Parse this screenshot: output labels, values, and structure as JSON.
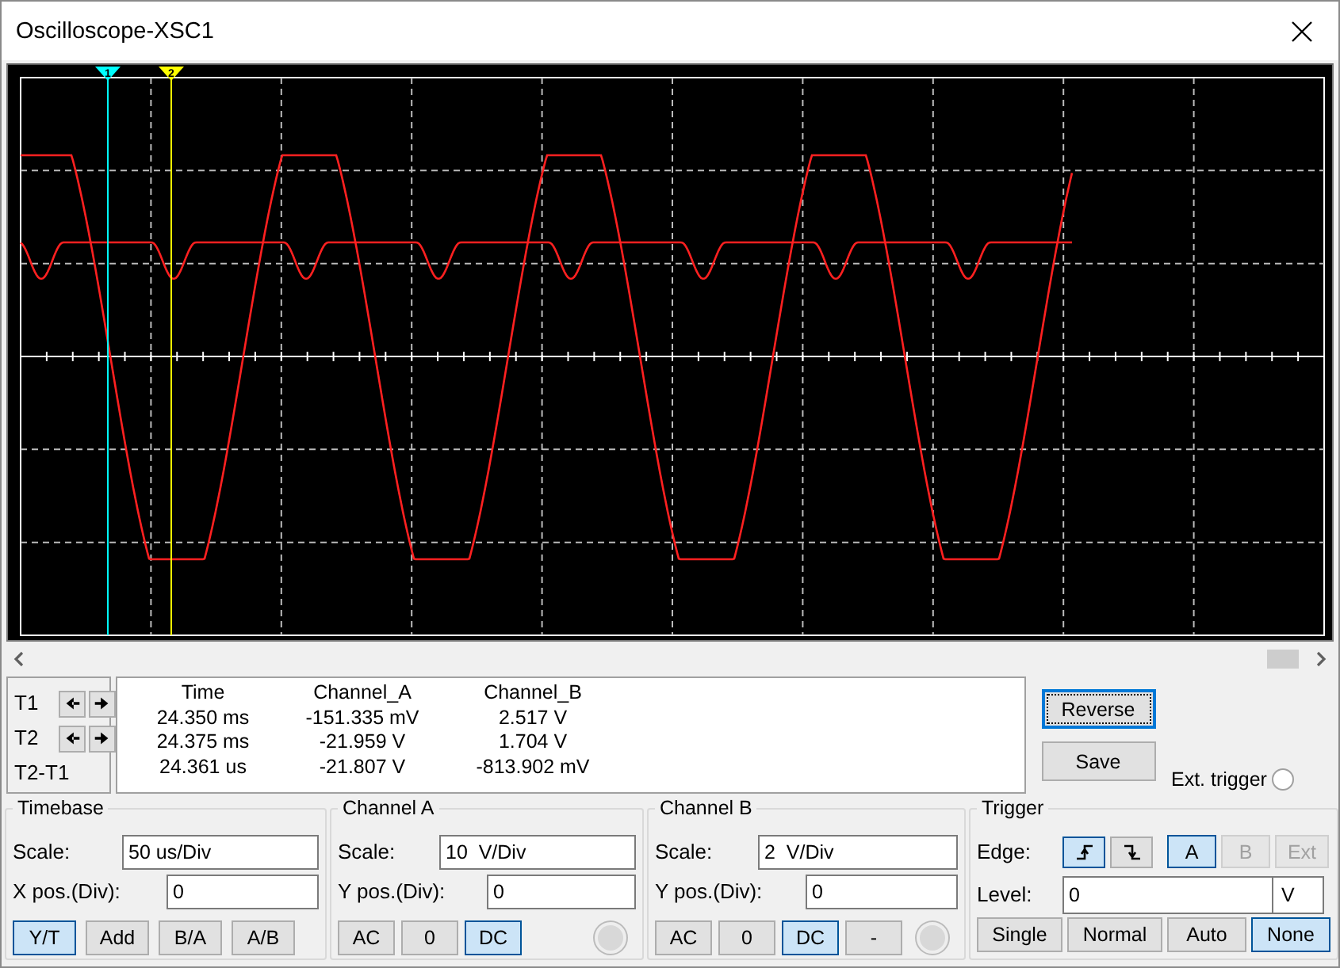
{
  "window": {
    "title": "Oscilloscope-XSC1"
  },
  "cursors": [
    {
      "label": "1",
      "color": "#00ffff"
    },
    {
      "label": "2",
      "color": "#ffff00"
    }
  ],
  "cursor_controls": [
    {
      "label": "T1",
      "arrows": true
    },
    {
      "label": "T2",
      "arrows": true
    },
    {
      "label": "T2-T1",
      "arrows": false
    }
  ],
  "readout": {
    "columns": [
      "Time",
      "Channel_A",
      "Channel_B"
    ],
    "rows": [
      [
        "24.350 ms",
        "-151.335 mV",
        "2.517 V"
      ],
      [
        "24.375 ms",
        "-21.959 V",
        "1.704 V"
      ],
      [
        "24.361 us",
        "-21.807 V",
        "-813.902 mV"
      ]
    ]
  },
  "buttons": [
    {
      "label": "Reverse",
      "focused": true
    },
    {
      "label": "Save",
      "focused": false
    }
  ],
  "ext_trigger": {
    "label": "Ext. trigger"
  },
  "timebase": {
    "title": "Timebase",
    "fields": [
      {
        "label": "Scale:",
        "value": "50 us/Div"
      },
      {
        "label": "X pos.(Div):",
        "value": "0"
      }
    ],
    "modes": [
      {
        "label": "Y/T",
        "selected": true
      },
      {
        "label": "Add",
        "selected": false
      },
      {
        "label": "B/A",
        "selected": false
      },
      {
        "label": "A/B",
        "selected": false
      }
    ]
  },
  "channel_a": {
    "title": "Channel A",
    "fields": [
      {
        "label": "Scale:",
        "value": "10  V/Div"
      },
      {
        "label": "Y pos.(Div):",
        "value": "0"
      }
    ],
    "coupling": [
      {
        "label": "AC",
        "selected": false
      },
      {
        "label": "0",
        "selected": false
      },
      {
        "label": "DC",
        "selected": true
      }
    ]
  },
  "channel_b": {
    "title": "Channel B",
    "fields": [
      {
        "label": "Scale:",
        "value": "2  V/Div"
      },
      {
        "label": "Y pos.(Div):",
        "value": "0"
      }
    ],
    "coupling": [
      {
        "label": "AC",
        "selected": false
      },
      {
        "label": "0",
        "selected": false
      },
      {
        "label": "DC",
        "selected": true
      },
      {
        "label": "-",
        "selected": false
      }
    ]
  },
  "trigger": {
    "title": "Trigger",
    "edge_label": "Edge:",
    "edges": [
      {
        "kind": "rising",
        "selected": true
      },
      {
        "kind": "falling",
        "selected": false
      }
    ],
    "sources": [
      {
        "label": "A",
        "selected": true,
        "disabled": false
      },
      {
        "label": "B",
        "selected": false,
        "disabled": true
      },
      {
        "label": "Ext",
        "selected": false,
        "disabled": true
      }
    ],
    "level_label": "Level:",
    "level_value": "0",
    "level_unit": "V",
    "modes": [
      {
        "label": "Single",
        "selected": false
      },
      {
        "label": "Normal",
        "selected": false
      },
      {
        "label": "Auto",
        "selected": false
      },
      {
        "label": "None",
        "selected": true
      }
    ]
  }
}
